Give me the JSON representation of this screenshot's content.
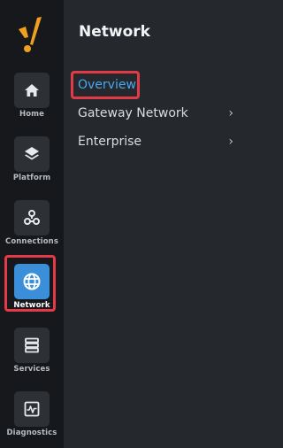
{
  "rail": {
    "items": [
      {
        "label": "Home",
        "icon": "home-icon"
      },
      {
        "label": "Platform",
        "icon": "layers-icon"
      },
      {
        "label": "Connections",
        "icon": "connections-icon"
      },
      {
        "label": "Network",
        "icon": "globe-icon",
        "active": true
      },
      {
        "label": "Services",
        "icon": "server-icon"
      },
      {
        "label": "Diagnostics",
        "icon": "pulse-icon"
      }
    ]
  },
  "panel": {
    "title": "Network",
    "items": [
      {
        "label": "Overview",
        "selected": true,
        "has_submenu": false
      },
      {
        "label": "Gateway Network",
        "selected": false,
        "has_submenu": true
      },
      {
        "label": "Enterprise",
        "selected": false,
        "has_submenu": true
      }
    ],
    "chevron": "›"
  },
  "colors": {
    "accent": "#3b8ed8",
    "highlight_outline": "#e23b47",
    "selected_text": "#4aa8f0",
    "logo": "#f0a01e"
  }
}
